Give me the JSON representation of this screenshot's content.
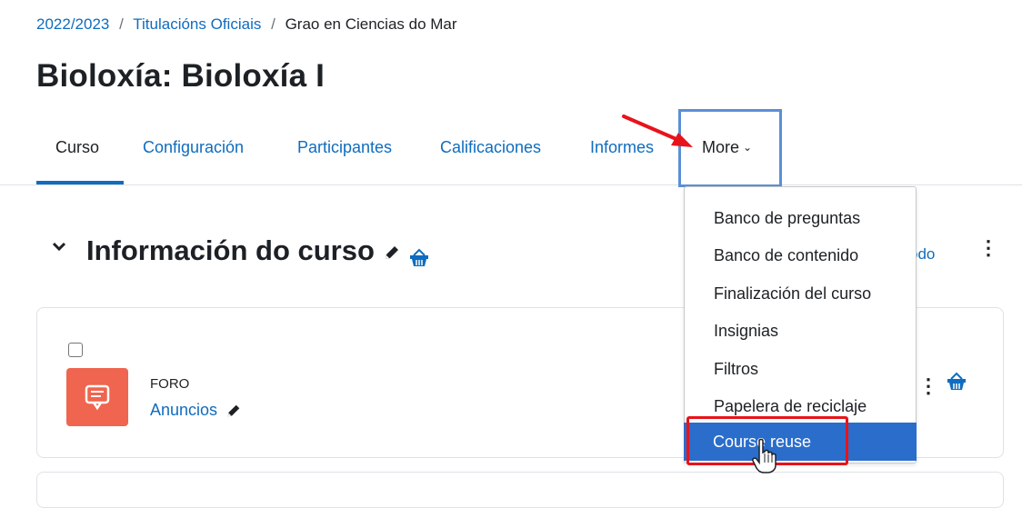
{
  "breadcrumb": {
    "item1": "2022/2023",
    "sep": "/",
    "item2": "Titulacións Oficiais",
    "item3": "Grao en Ciencias do Mar"
  },
  "page_title": "Bioloxía: Bioloxía I",
  "tabs": {
    "curso": "Curso",
    "configuracion": "Configuración",
    "participantes": "Participantes",
    "calificaciones": "Calificaciones",
    "informes": "Informes",
    "more": "More"
  },
  "section": {
    "title": "Información do curso",
    "side_text": "odo"
  },
  "activity": {
    "type": "FORO",
    "name": "Anuncios"
  },
  "dropdown": {
    "items": [
      "Banco de preguntas",
      "Banco de contenido",
      "Finalización del curso",
      "Insignias",
      "Filtros",
      "Papelera de reciclaje"
    ],
    "highlighted": "Course reuse"
  },
  "colors": {
    "link": "#0f6cbf",
    "highlight": "#2a6dcb",
    "annotation_red": "#e8131a",
    "forum_icon": "#f0654f"
  }
}
